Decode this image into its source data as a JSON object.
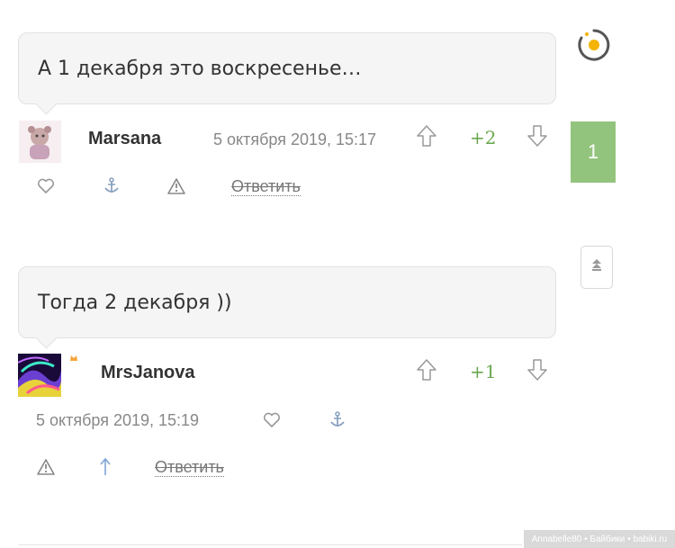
{
  "comments": [
    {
      "text": "А 1 декабря это воскресенье…",
      "author": "Marsana",
      "date": "5 октября 2019, 15:17",
      "score": "+2",
      "reply_label": "Ответить"
    },
    {
      "text": "Тогда 2 декабря ))",
      "author": "MrsJanova",
      "date": "5 октября 2019, 15:19",
      "score": "+1",
      "reply_label": "Ответить"
    }
  ],
  "new_comments_badge": "1",
  "colors": {
    "score": "#6aa84f",
    "badge": "#93c47d",
    "accent": "#f4b400"
  },
  "icons": [
    "loading-icon",
    "heart-icon",
    "anchor-icon",
    "warning-icon",
    "arrow-up-icon",
    "vote-up-icon",
    "vote-down-icon",
    "scroll-top-icon",
    "crown-icon"
  ],
  "watermark": "Annabelle80 • Байбики • babiki.ru"
}
